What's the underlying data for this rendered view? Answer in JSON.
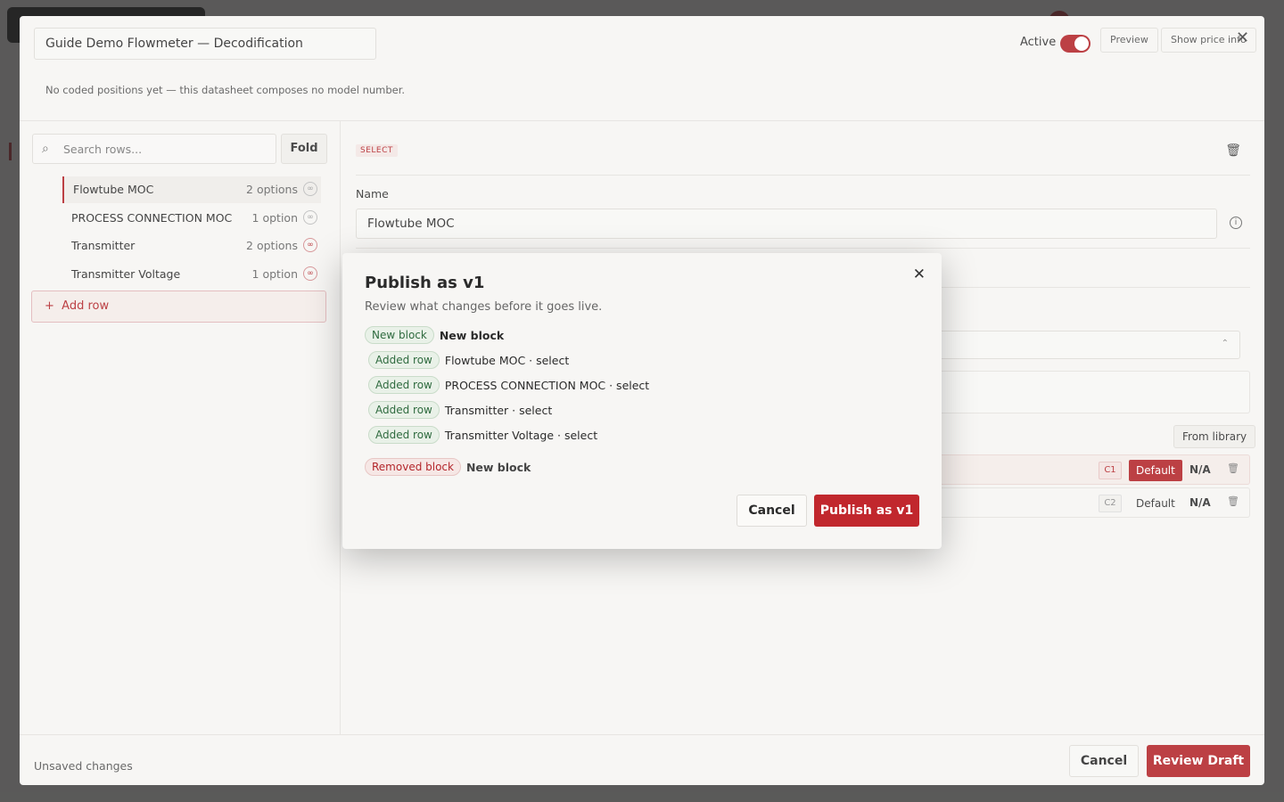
{
  "editor": {
    "title_value": "Guide Demo Flowmeter — Decodification",
    "active_label": "Active",
    "preview_label": "Preview",
    "price_info_label": "Show price info",
    "notice": "No coded positions yet — this datasheet composes no model number.",
    "search_placeholder": "Search rows...",
    "fold_label": "Fold",
    "rows": [
      {
        "name": "Flowtube MOC",
        "count": "2 options"
      },
      {
        "name": "PROCESS CONNECTION MOC",
        "count": "1 option"
      },
      {
        "name": "Transmitter",
        "count": "2 options"
      },
      {
        "name": "Transmitter Voltage",
        "count": "1 option"
      }
    ],
    "add_row_label": "Add row",
    "badge": "SELECT",
    "name_label": "Name",
    "name_value": "Flowtube MOC",
    "from_library_label": "From library",
    "options": [
      {
        "code": "C1",
        "default_label": "Default",
        "value": "N/A"
      },
      {
        "code": "C2",
        "default_label": "Default",
        "value": "N/A"
      }
    ],
    "unsaved": "Unsaved changes",
    "cancel_label": "Cancel",
    "review_label": "Review Draft"
  },
  "modal": {
    "title": "Publish as v1",
    "subtitle": "Review what changes before it goes live.",
    "changes": [
      {
        "pill": "New block",
        "text": "New block"
      },
      {
        "pill": "Added row",
        "text": "Flowtube MOC · select"
      },
      {
        "pill": "Added row",
        "text": "PROCESS CONNECTION MOC · select"
      },
      {
        "pill": "Added row",
        "text": "Transmitter · select"
      },
      {
        "pill": "Added row",
        "text": "Transmitter Voltage · select"
      },
      {
        "pill": "Removed block",
        "text": "New block"
      }
    ],
    "cancel_label": "Cancel",
    "publish_label": "Publish as v1"
  },
  "colors": {
    "accent": "#b3262b",
    "added": "#2f6b3f"
  },
  "icons": {
    "search": "search-icon",
    "close": "close-icon",
    "trash": "trash-icon",
    "info": "info-icon",
    "link": "link-icon"
  }
}
